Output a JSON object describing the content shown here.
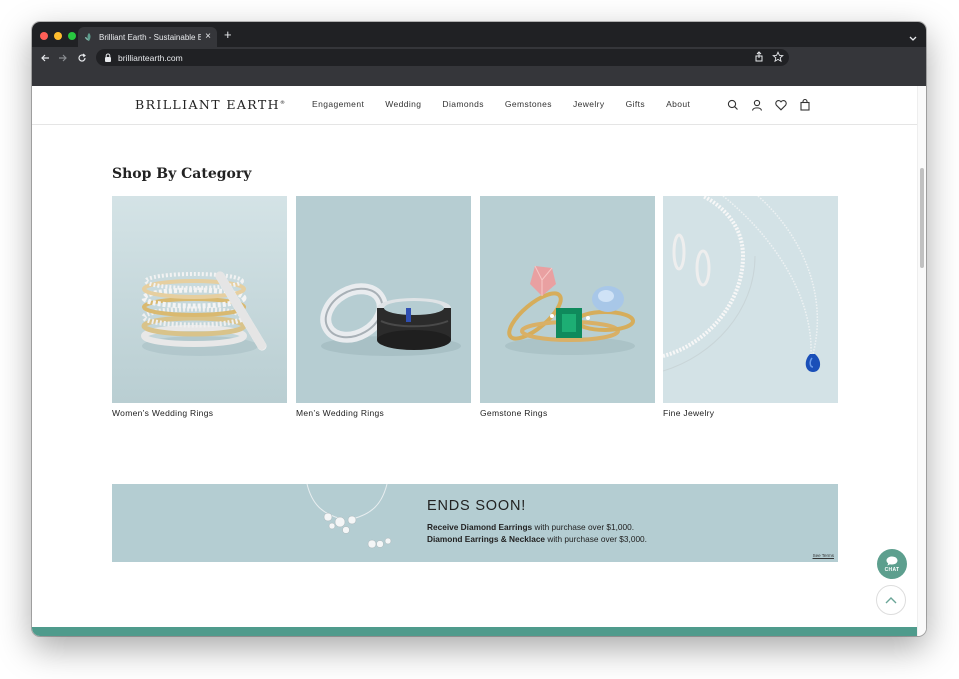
{
  "browser": {
    "tab_title": "Brilliant Earth - Sustainable En",
    "new_tab": "+",
    "address": "brilliantearth.com",
    "colors": {
      "close": "#ff5f57",
      "minimize": "#febc2e",
      "maximize": "#28c840"
    }
  },
  "header": {
    "logo": "BRILLIANT EARTH",
    "logo_mark": "®",
    "nav": [
      "Engagement",
      "Wedding",
      "Diamonds",
      "Gemstones",
      "Jewelry",
      "Gifts",
      "About"
    ]
  },
  "section": {
    "title": "Shop By Category",
    "categories": [
      {
        "label": "Women’s Wedding Rings",
        "bg": "#c9dbde"
      },
      {
        "label": "Men’s Wedding Rings",
        "bg": "#b6cdd2"
      },
      {
        "label": "Gemstone Rings",
        "bg": "#b2c9cd"
      },
      {
        "label": "Fine Jewelry",
        "bg": "#d3e2e6"
      }
    ]
  },
  "promo": {
    "title": "ENDS SOON!",
    "line1_bold": "Receive Diamond Earrings",
    "line1_rest": " with purchase over $1,000.",
    "line2_bold": "Diamond Earrings & Necklace",
    "line2_rest": " with purchase over $3,000.",
    "terms": "See Terms"
  },
  "widgets": {
    "chat": "CHAT"
  },
  "colors": {
    "accent": "#5d9f8e",
    "footer": "#4f9b8c"
  }
}
